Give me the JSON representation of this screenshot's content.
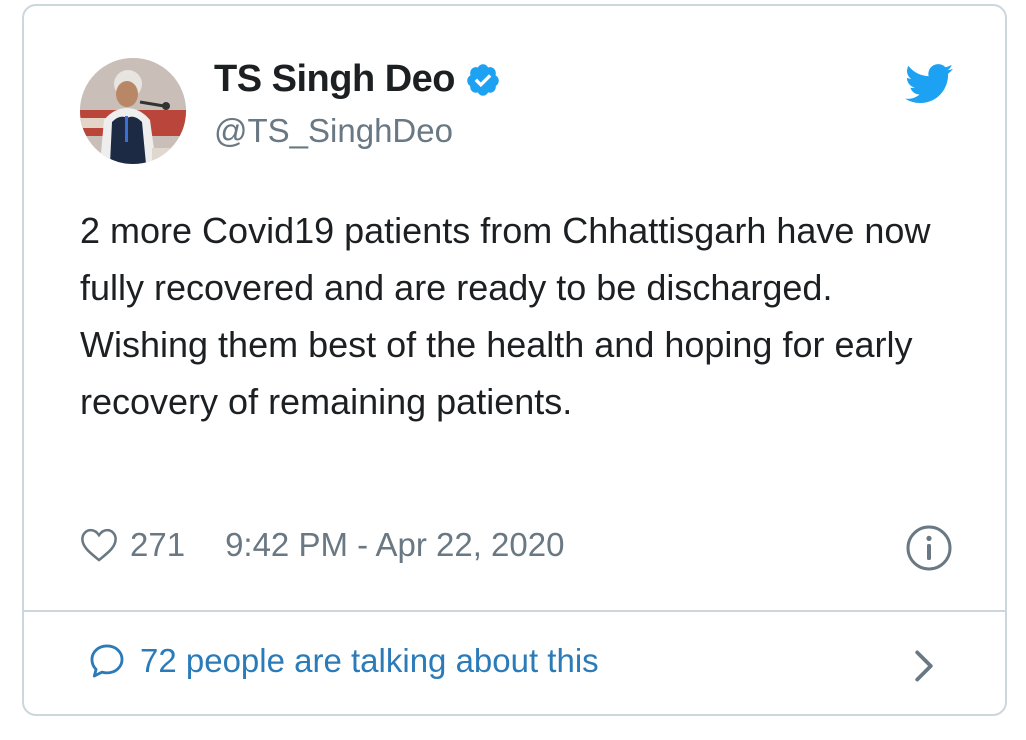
{
  "author": {
    "display_name": "TS Singh Deo",
    "handle": "@TS_SinghDeo",
    "verified": true
  },
  "tweet": {
    "text": "2 more Covid19 patients from Chhattisgarh have now fully recovered and are ready to be discharged. Wishing them best of the health and hoping for early recovery of remaining patients.",
    "likes": "271",
    "timestamp": "9:42 PM - Apr 22, 2020"
  },
  "footer": {
    "talking_label": "72 people are talking about this"
  },
  "icons": {
    "brand": "twitter-bird-icon",
    "verified": "verified-badge-icon",
    "like": "heart-icon",
    "info": "info-icon",
    "conversation": "speech-bubble-icon",
    "more": "chevron-right-icon"
  },
  "colors": {
    "accent": "#1da1f2",
    "link": "#2b7bb9",
    "muted": "#697882",
    "text": "#1c2022",
    "border": "#ccd6dd"
  }
}
